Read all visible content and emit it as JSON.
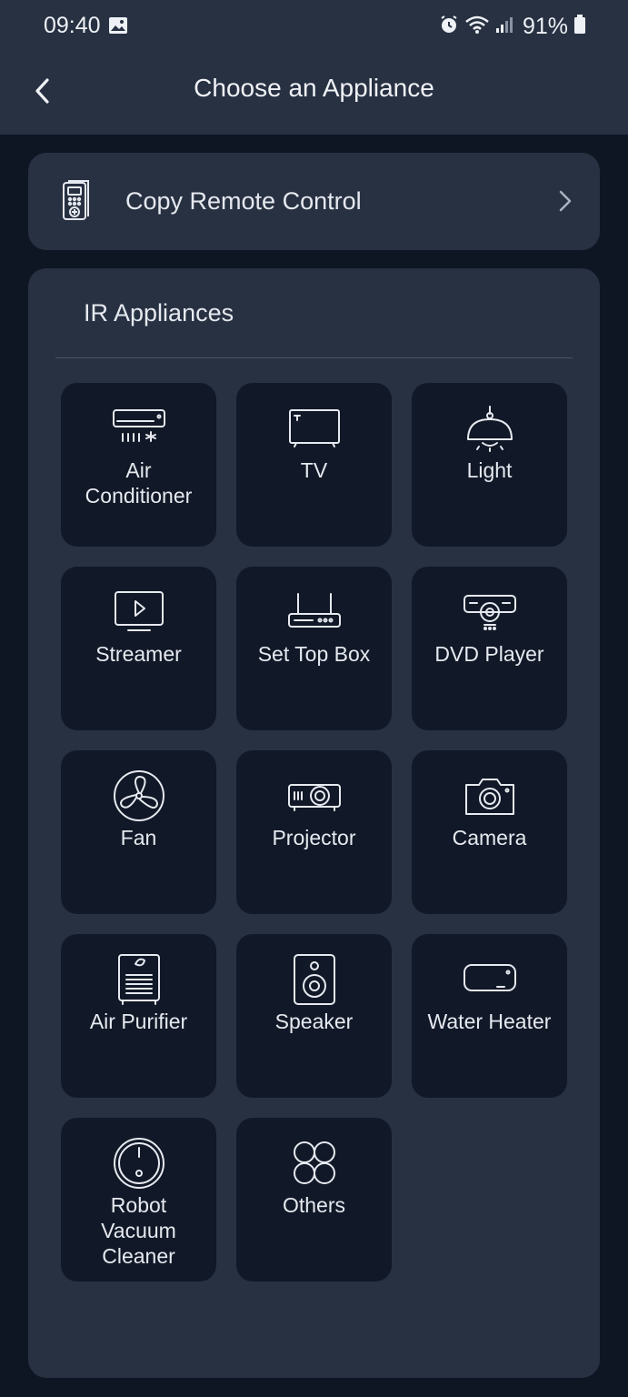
{
  "status_bar": {
    "time": "09:40",
    "battery": "91%"
  },
  "header": {
    "title": "Choose an Appliance"
  },
  "copy_remote": {
    "label": "Copy Remote Control"
  },
  "ir_section": {
    "title": "IR Appliances",
    "appliances": [
      {
        "label": "Air\nConditioner",
        "icon": "air-conditioner-icon"
      },
      {
        "label": "TV",
        "icon": "tv-icon"
      },
      {
        "label": "Light",
        "icon": "light-icon"
      },
      {
        "label": "Streamer",
        "icon": "streamer-icon"
      },
      {
        "label": "Set Top Box",
        "icon": "set-top-box-icon"
      },
      {
        "label": "DVD Player",
        "icon": "dvd-player-icon"
      },
      {
        "label": "Fan",
        "icon": "fan-icon"
      },
      {
        "label": "Projector",
        "icon": "projector-icon"
      },
      {
        "label": "Camera",
        "icon": "camera-icon"
      },
      {
        "label": "Air Purifier",
        "icon": "air-purifier-icon"
      },
      {
        "label": "Speaker",
        "icon": "speaker-icon"
      },
      {
        "label": "Water Heater",
        "icon": "water-heater-icon"
      },
      {
        "label": "Robot\nVacuum\nCleaner",
        "icon": "robot-vacuum-icon"
      },
      {
        "label": "Others",
        "icon": "others-icon"
      }
    ]
  },
  "colors": {
    "background": "#0f1623",
    "surface": "#273142",
    "tile": "#111827",
    "text": "#e6e9ef"
  }
}
